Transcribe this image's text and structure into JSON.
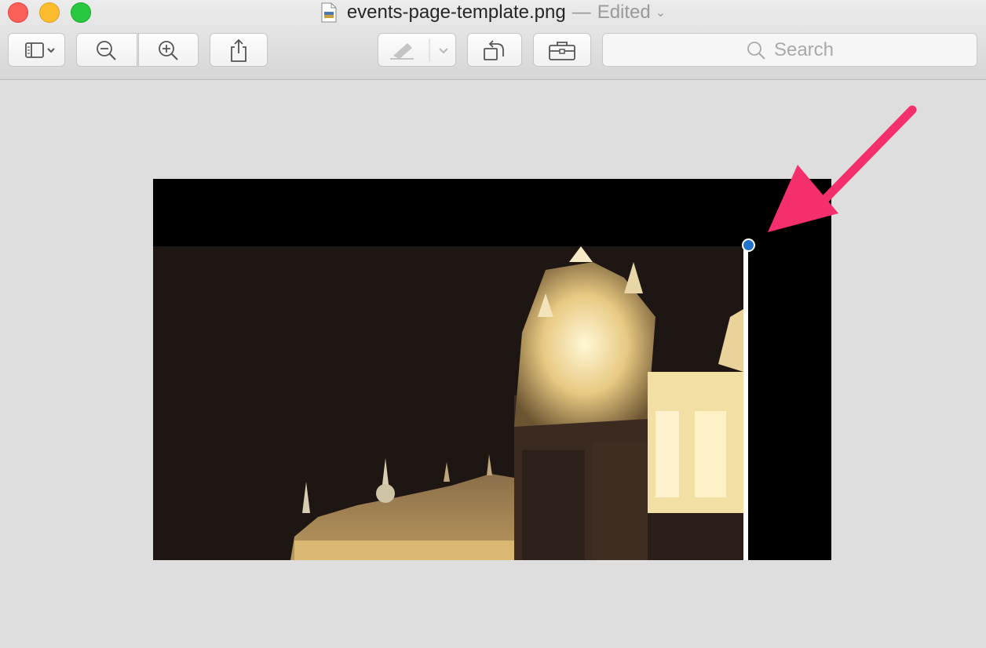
{
  "window": {
    "filename": "events-page-template.png",
    "separator": "—",
    "status": "Edited"
  },
  "toolbar": {
    "sidebar_button": "sidebar-toggle",
    "zoom_out": "zoom-out",
    "zoom_in": "zoom-in",
    "share": "share",
    "markup": "markup",
    "rotate": "rotate",
    "toolbox": "toolbox"
  },
  "search": {
    "placeholder": "Search"
  },
  "colors": {
    "accent_handle": "#1f74c9",
    "annotation_arrow": "#f52e6c"
  }
}
